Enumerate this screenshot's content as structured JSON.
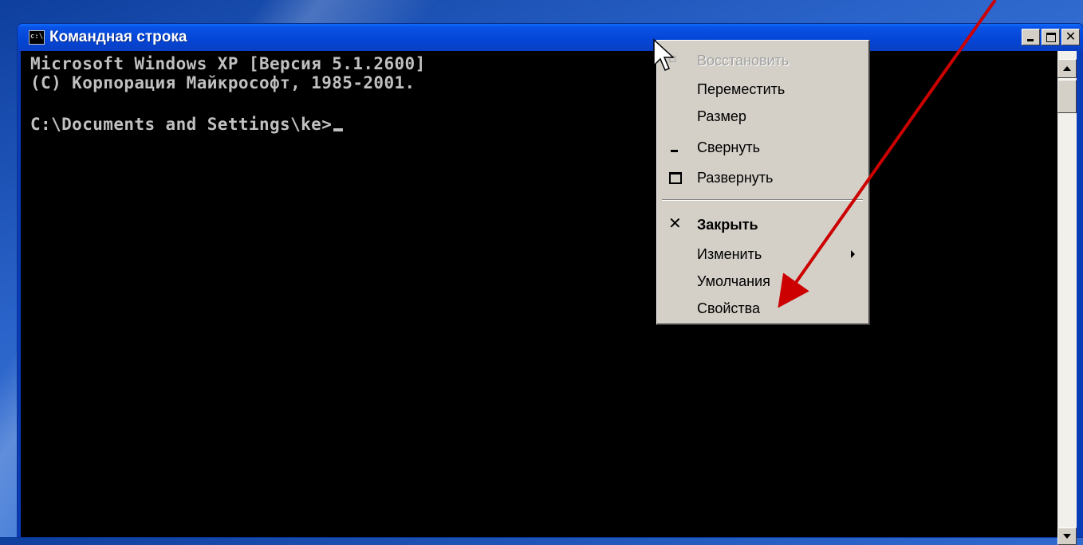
{
  "window": {
    "title": "Командная строка",
    "icon": "cmd-icon",
    "icon_text": "c:\\",
    "controls": [
      "minimize-icon",
      "maximize-icon",
      "close-icon"
    ],
    "close_glyph": "✕"
  },
  "console": {
    "lines": [
      "Microsoft Windows XP [Версия 5.1.2600]",
      "(С) Корпорация Майкрософт, 1985-2001.",
      "",
      "C:\\Documents and Settings\\ke>"
    ],
    "text_color": "#c0c0c0",
    "background": "#000000"
  },
  "context_menu": {
    "items": [
      {
        "label": "Восстановить",
        "icon": "restore-icon",
        "disabled": true
      },
      {
        "label": "Переместить"
      },
      {
        "label": "Размер"
      },
      {
        "label": "Свернуть",
        "icon": "minimize-icon"
      },
      {
        "label": "Развернуть",
        "icon": "maximize-icon"
      },
      {
        "label": "Закрыть",
        "icon": "close-icon",
        "bold": true
      },
      {
        "label": "Изменить",
        "submenu": true
      },
      {
        "label": "Умолчания"
      },
      {
        "label": "Свойства"
      }
    ]
  },
  "annotation": {
    "type": "arrow",
    "color": "#cc0000",
    "points_to": "Свойства"
  },
  "colors": {
    "titlebar": "#0445d5",
    "menu_bg": "#d4d0c8",
    "desktop": "#2a63c9"
  }
}
